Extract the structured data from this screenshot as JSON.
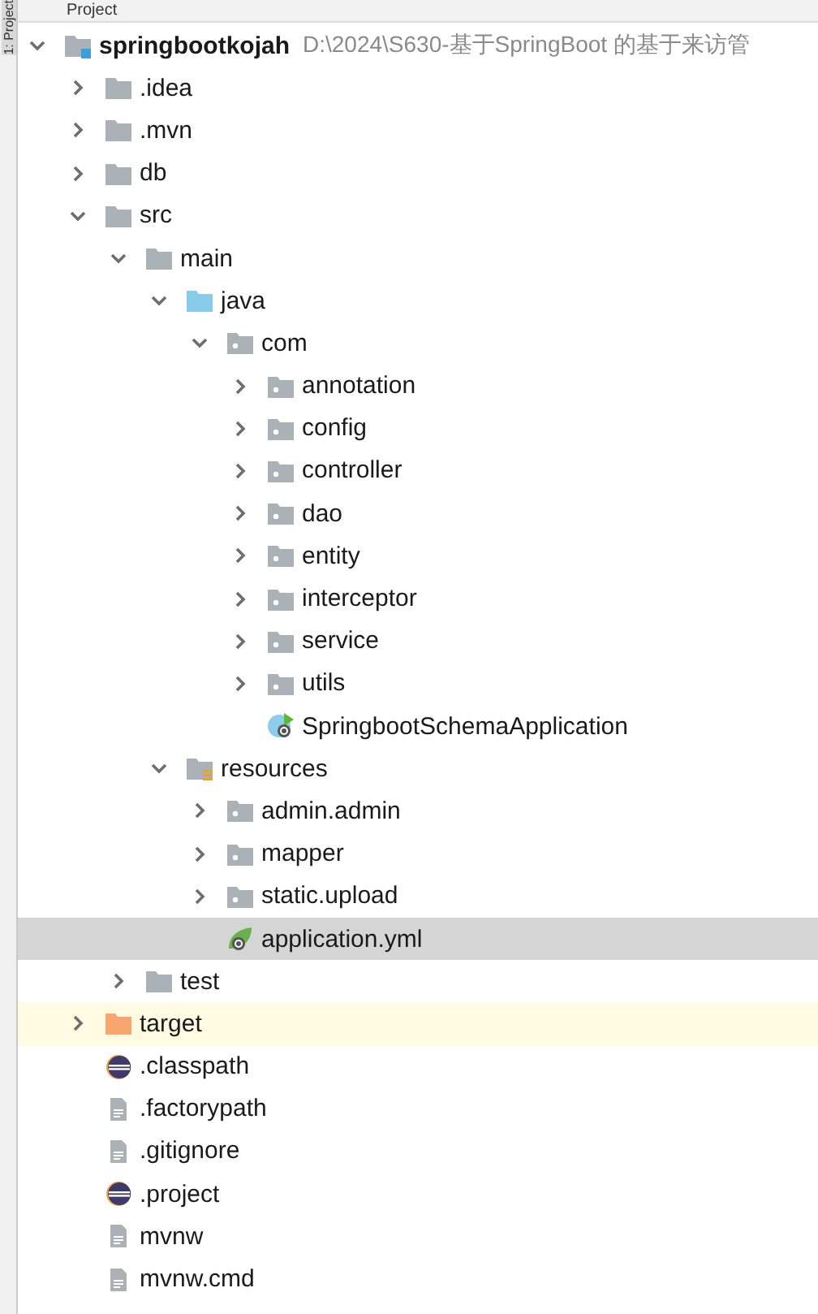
{
  "sidebar_tab": "1: Project",
  "panel": {
    "title": "Project"
  },
  "tree": [
    {
      "name": "springbootkojah",
      "path": "D:\\2024\\S630-基于SpringBoot 的基于来访管",
      "kind": "module",
      "expanded": true,
      "selected": false,
      "children": [
        {
          "name": ".idea",
          "kind": "folder",
          "expanded": false,
          "selected": false
        },
        {
          "name": ".mvn",
          "kind": "folder",
          "expanded": false,
          "selected": false
        },
        {
          "name": "db",
          "kind": "folder",
          "expanded": false,
          "selected": false
        },
        {
          "name": "src",
          "kind": "folder",
          "expanded": true,
          "selected": false,
          "children": [
            {
              "name": "main",
              "kind": "folder",
              "expanded": true,
              "selected": false,
              "children": [
                {
                  "name": "java",
                  "kind": "source",
                  "expanded": true,
                  "selected": false,
                  "children": [
                    {
                      "name": "com",
                      "kind": "package",
                      "expanded": true,
                      "selected": false,
                      "children": [
                        {
                          "name": "annotation",
                          "kind": "package",
                          "expanded": false,
                          "selected": false
                        },
                        {
                          "name": "config",
                          "kind": "package",
                          "expanded": false,
                          "selected": false
                        },
                        {
                          "name": "controller",
                          "kind": "package",
                          "expanded": false,
                          "selected": false
                        },
                        {
                          "name": "dao",
                          "kind": "package",
                          "expanded": false,
                          "selected": false
                        },
                        {
                          "name": "entity",
                          "kind": "package",
                          "expanded": false,
                          "selected": false
                        },
                        {
                          "name": "interceptor",
                          "kind": "package",
                          "expanded": false,
                          "selected": false
                        },
                        {
                          "name": "service",
                          "kind": "package",
                          "expanded": false,
                          "selected": false
                        },
                        {
                          "name": "utils",
                          "kind": "package",
                          "expanded": false,
                          "selected": false
                        },
                        {
                          "name": "SpringbootSchemaApplication",
                          "kind": "spring-class",
                          "selected": false
                        }
                      ]
                    }
                  ]
                },
                {
                  "name": "resources",
                  "kind": "resources",
                  "expanded": true,
                  "selected": false,
                  "children": [
                    {
                      "name": "admin.admin",
                      "kind": "package",
                      "expanded": false,
                      "selected": false
                    },
                    {
                      "name": "mapper",
                      "kind": "package",
                      "expanded": false,
                      "selected": false
                    },
                    {
                      "name": "static.upload",
                      "kind": "package",
                      "expanded": false,
                      "selected": false
                    },
                    {
                      "name": "application.yml",
                      "kind": "spring-config",
                      "selected": true
                    }
                  ]
                }
              ]
            },
            {
              "name": "test",
              "kind": "folder",
              "expanded": false,
              "selected": false
            }
          ]
        },
        {
          "name": "target",
          "kind": "excluded",
          "expanded": false,
          "selected": false
        },
        {
          "name": ".classpath",
          "kind": "eclipse",
          "selected": false
        },
        {
          "name": ".factorypath",
          "kind": "file",
          "selected": false
        },
        {
          "name": ".gitignore",
          "kind": "file",
          "selected": false
        },
        {
          "name": ".project",
          "kind": "eclipse",
          "selected": false
        },
        {
          "name": "mvnw",
          "kind": "file",
          "selected": false
        },
        {
          "name": "mvnw.cmd",
          "kind": "file",
          "selected": false
        }
      ]
    }
  ]
}
